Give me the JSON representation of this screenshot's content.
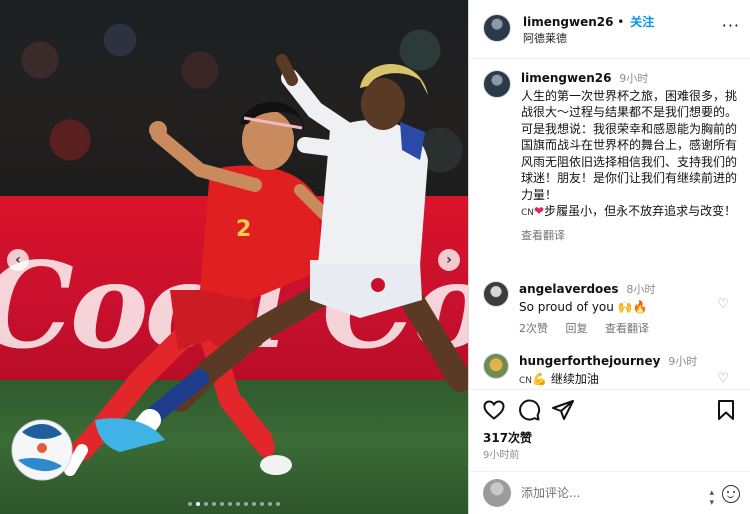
{
  "photo": {
    "banner_text": "Coca Cola",
    "jersey_number": "2",
    "carousel": {
      "prev_icon": "chevron-left-icon",
      "next_icon": "chevron-right-icon",
      "dot_count": 12,
      "active_dot": 1
    }
  },
  "post": {
    "username": "limengwen26",
    "separator": "•",
    "follow_label": "关注",
    "location": "阿德莱德",
    "more_icon": "more-icon",
    "more_label": "···"
  },
  "caption": {
    "username": "limengwen26",
    "time": "9小时",
    "lines": [
      "人生的第一次世界杯之旅，困难很多，挑战很大～过程与结果都不是我们想要的。",
      "可是我想说：我很荣幸和感恩能为胸前的国旗而战斗在世界杯的舞台上，感谢所有风雨无阻依旧选择相信我们、支持我们的球迷！朋友！是你们让我们有继续前进的力量！"
    ],
    "last_prefix": "CN",
    "last_text": "步履虽小，但永不放弃追求与改变！",
    "see_translation": "查看翻译"
  },
  "comments": [
    {
      "username": "angelaverdoes",
      "time": "8小时",
      "text": "So proud of you 🙌🔥",
      "likes": "2次赞",
      "reply": "回复",
      "translate": "查看翻译"
    },
    {
      "username": "hungerforthejourney",
      "time": "9小时",
      "prefix": "CN",
      "text": "继续加油"
    }
  ],
  "actions": {
    "like_icon": "heart-icon",
    "comment_icon": "comment-icon",
    "share_icon": "share-icon",
    "save_icon": "bookmark-icon",
    "likes": "317次赞",
    "time": "9小时前"
  },
  "comment_box": {
    "placeholder": "添加评论...",
    "emoji_icon": "emoji-icon"
  },
  "colors": {
    "link_blue": "#0095f6",
    "banner_red": "#c8102e",
    "china_red": "#e02020",
    "haiti_white": "#eef0f4"
  }
}
